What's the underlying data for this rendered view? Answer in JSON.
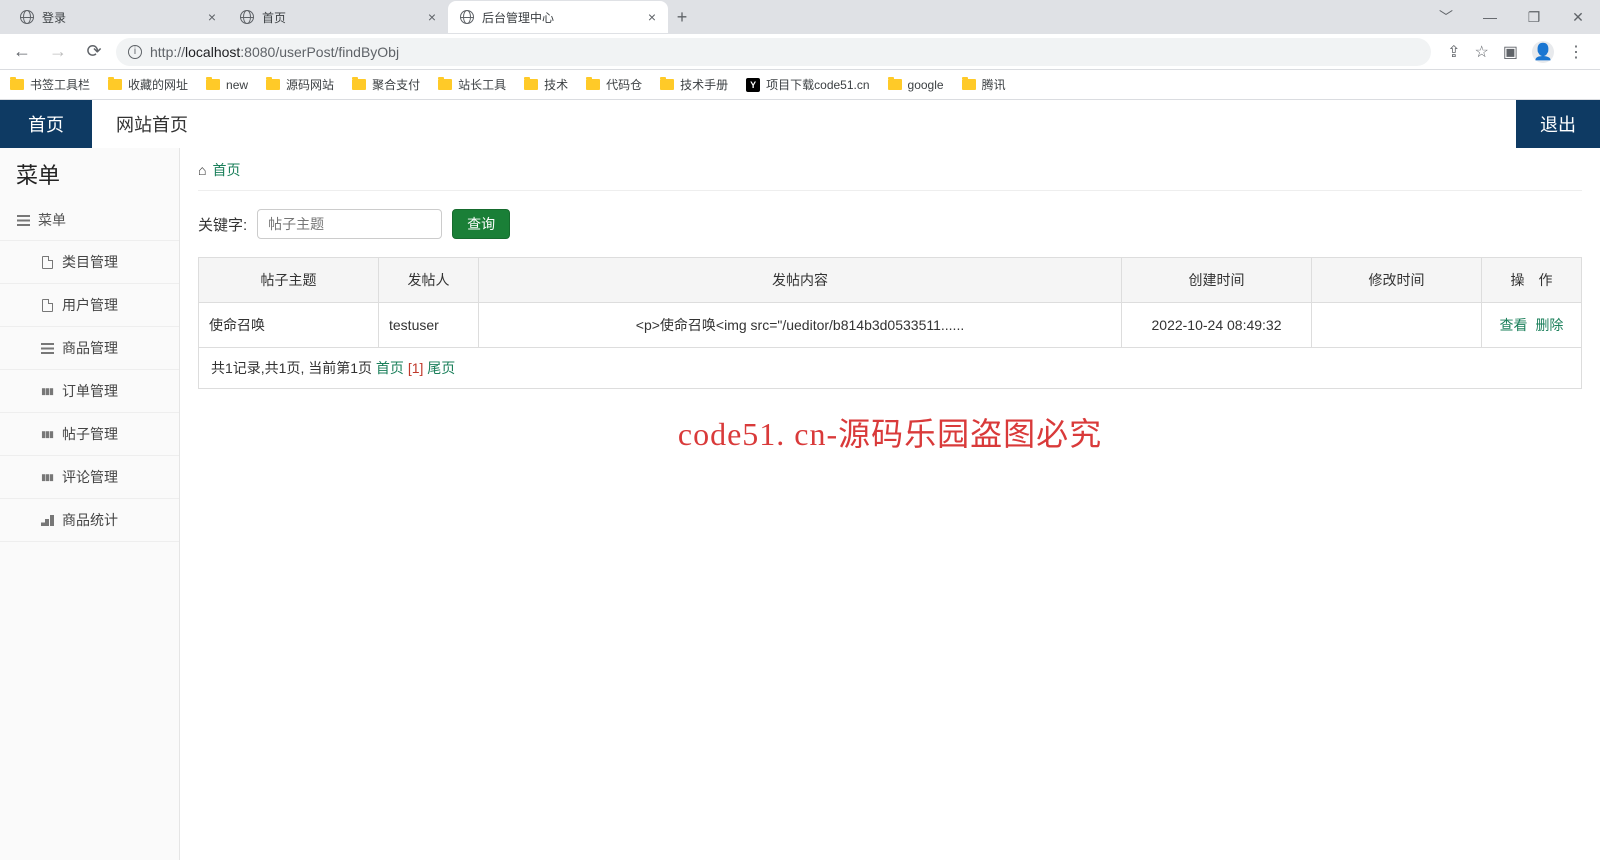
{
  "browser": {
    "tabs": [
      {
        "title": "登录"
      },
      {
        "title": "首页"
      },
      {
        "title": "后台管理中心"
      }
    ],
    "url_host_prefix": "http://",
    "url_host": "localhost",
    "url_port": ":8080",
    "url_path": "/userPost/findByObj"
  },
  "bookmarks": [
    "书签工具栏",
    "收藏的网址",
    "new",
    "源码网站",
    "聚合支付",
    "站长工具",
    "技术",
    "代码仓",
    "技术手册",
    "项目下载code51.cn",
    "google",
    "腾讯"
  ],
  "nav": {
    "home": "首页",
    "site": "网站首页",
    "logout": "退出"
  },
  "sidebar": {
    "title": "菜单",
    "root": "菜单",
    "items": [
      {
        "label": "类目管理",
        "icon": "doc"
      },
      {
        "label": "用户管理",
        "icon": "doc"
      },
      {
        "label": "商品管理",
        "icon": "list"
      },
      {
        "label": "订单管理",
        "icon": "books"
      },
      {
        "label": "帖子管理",
        "icon": "books"
      },
      {
        "label": "评论管理",
        "icon": "books"
      },
      {
        "label": "商品统计",
        "icon": "bar"
      }
    ]
  },
  "breadcrumb": {
    "home": "首页"
  },
  "search": {
    "label": "关键字:",
    "placeholder": "帖子主题",
    "button": "查询"
  },
  "table": {
    "headers": [
      "帖子主题",
      "发帖人",
      "发帖内容",
      "创建时间",
      "修改时间",
      "操　作"
    ],
    "rows": [
      {
        "topic": "使命召唤",
        "poster": "testuser",
        "content": "<p>使命召唤<img src=\"/ueditor/b814b3d0533511......",
        "created": "2022-10-24 08:49:32",
        "modified": "",
        "ops": {
          "view": "查看",
          "delete": "删除"
        }
      }
    ],
    "pager": {
      "summary": "共1记录,共1页, 当前第1页 ",
      "first": "首页",
      "current": "[1]",
      "last": "尾页"
    }
  },
  "watermark": "code51. cn-源码乐园盗图必究"
}
